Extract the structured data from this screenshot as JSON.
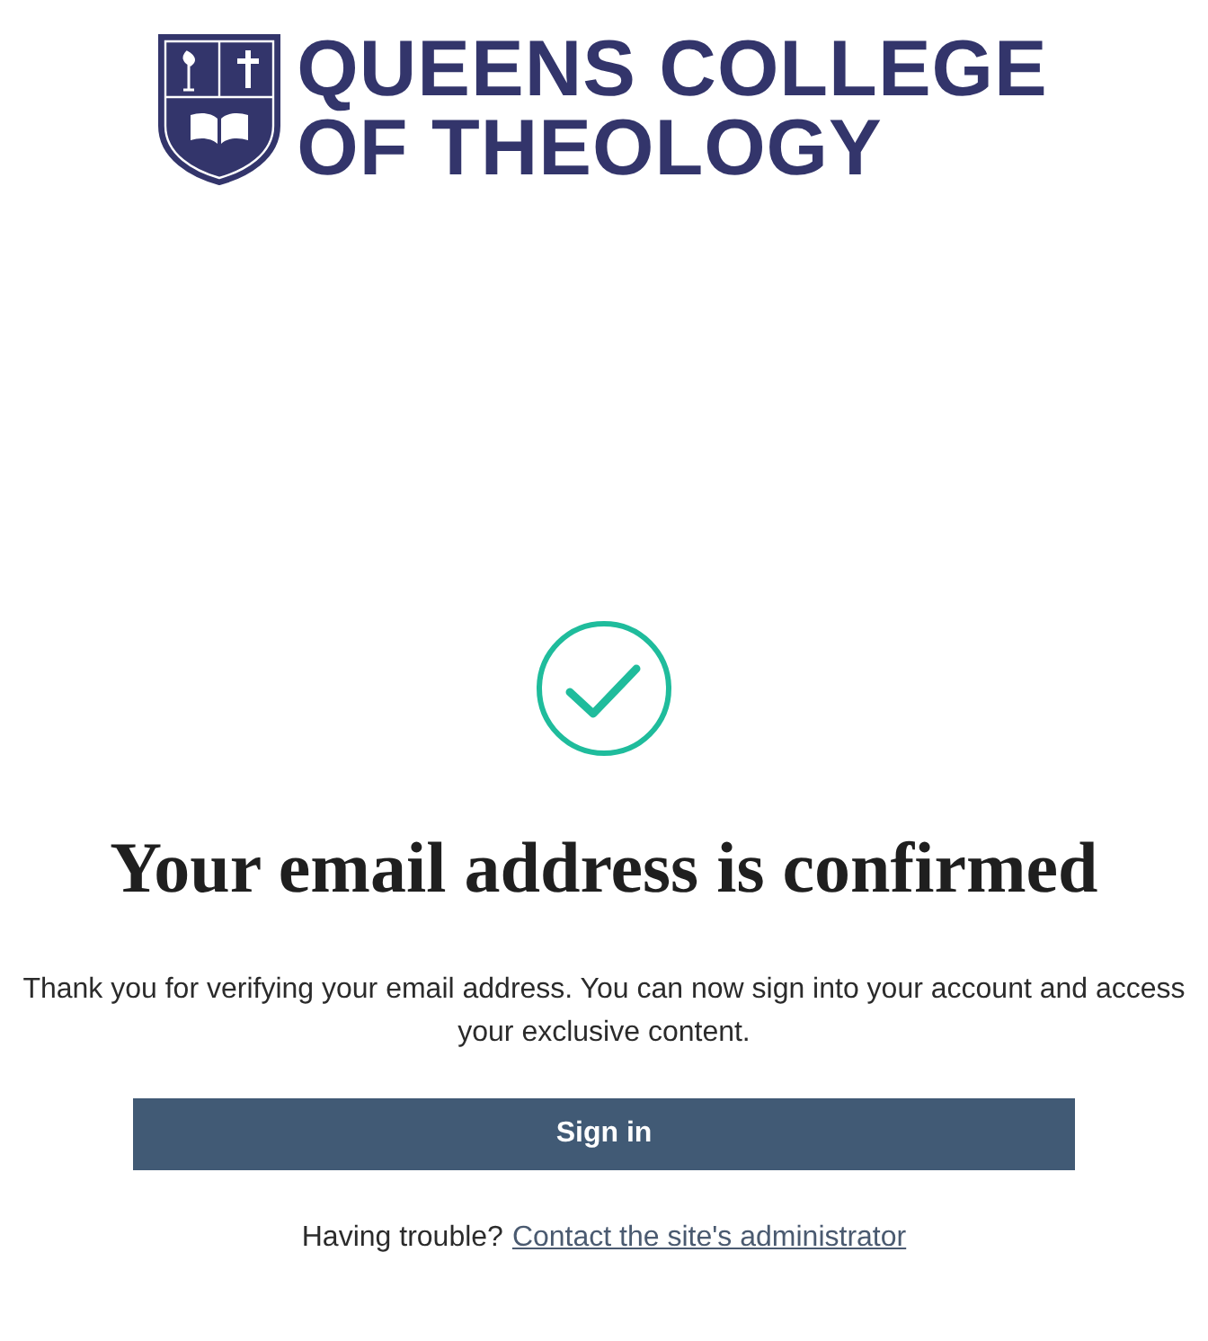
{
  "logo": {
    "lines": [
      "QUEENS COLLEGE",
      "OF THEOLOGY"
    ]
  },
  "heading": "Your email address is confirmed",
  "message": "Thank you for verifying your email address. You can now sign into your account and access your exclusive content.",
  "button": "Sign in",
  "help": {
    "text": "Having trouble?",
    "link": "Contact the site's administrator"
  }
}
